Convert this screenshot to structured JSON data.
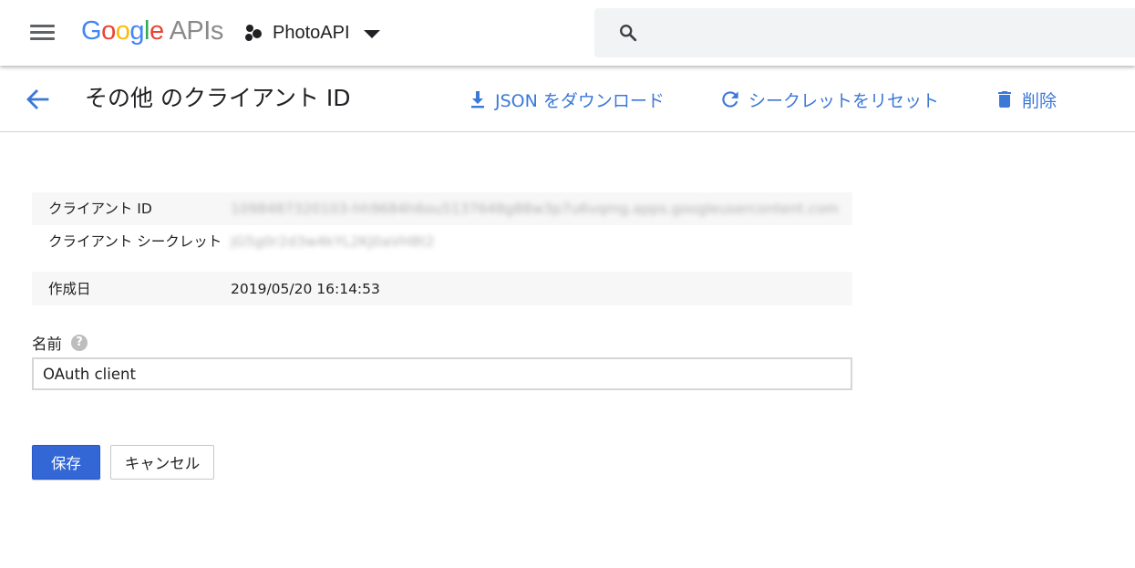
{
  "appbar": {
    "logo": {
      "letters": [
        {
          "char": "G",
          "color": "#4285f4"
        },
        {
          "char": "o",
          "color": "#ea4335"
        },
        {
          "char": "o",
          "color": "#fbbc05"
        },
        {
          "char": "g",
          "color": "#4285f4"
        },
        {
          "char": "l",
          "color": "#34a853"
        },
        {
          "char": "e",
          "color": "#ea4335"
        }
      ],
      "suffix": "APIs"
    },
    "project_name": "PhotoAPI",
    "search_value": ""
  },
  "header": {
    "title": "その他 のクライアント ID",
    "actions": {
      "download": "JSON をダウンロード",
      "reset": "シークレットをリセット",
      "delete": "削除"
    }
  },
  "info": {
    "rows": [
      {
        "key": "クライアント ID",
        "value": "1098487320103-hh9684h6ou5137648g88w3p7u6vqmg.apps.googleusercontent.com",
        "blurred": true
      },
      {
        "key": "クライアント シークレット",
        "value": "jG5g0r2d3w4kYL2KJ0aVH8t2",
        "blurred": true
      },
      {
        "key": "作成日",
        "value": "2019/05/20 16:14:53",
        "blurred": false
      }
    ]
  },
  "form": {
    "name_label": "名前",
    "help_glyph": "?",
    "name_value": "OAuth client",
    "save_label": "保存",
    "cancel_label": "キャンセル"
  },
  "colors": {
    "accent": "#3c78d8",
    "save_button": "#3367d6",
    "search_bg": "#f1f3f4"
  },
  "icons": {
    "menu": "hamburger-icon",
    "project": "project-dots-icon",
    "search": "search-icon",
    "back": "arrow-back-icon",
    "download": "download-icon",
    "reset": "refresh-icon",
    "delete": "trash-icon",
    "help": "help-icon"
  }
}
